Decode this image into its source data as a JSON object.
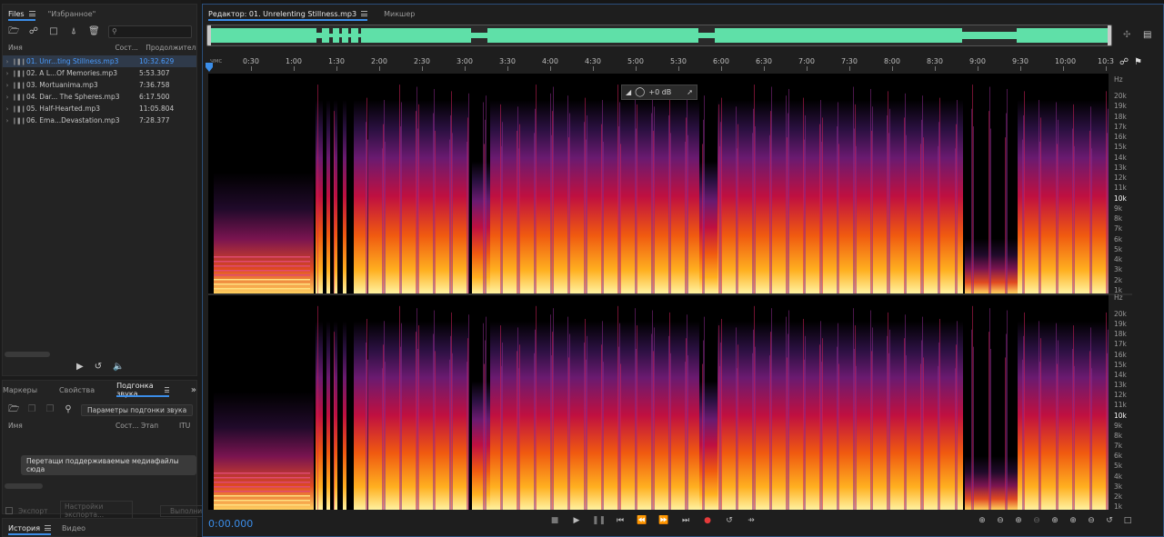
{
  "files_panel": {
    "tabs": [
      {
        "label": "Files",
        "active": true
      },
      {
        "label": "\"Избранное\"",
        "active": false
      }
    ],
    "search_placeholder": "",
    "columns": {
      "name": "Имя",
      "status": "Сост...",
      "duration": "Продолжительн..."
    },
    "files": [
      {
        "name": "01. Unr...ting Stillness.mp3",
        "duration": "10:32.629",
        "selected": true
      },
      {
        "name": "02. A L...Of Memories.mp3",
        "duration": "5:53.307",
        "selected": false
      },
      {
        "name": "03. Mortuanima.mp3",
        "duration": "7:36.758",
        "selected": false
      },
      {
        "name": "04. Dar... The Spheres.mp3",
        "duration": "6:17.500",
        "selected": false
      },
      {
        "name": "05. Half-Hearted.mp3",
        "duration": "11:05.804",
        "selected": false
      },
      {
        "name": "06. Ema...Devastation.mp3",
        "duration": "7:28.377",
        "selected": false
      }
    ]
  },
  "match_panel": {
    "tabs": [
      {
        "label": "Маркеры",
        "active": false
      },
      {
        "label": "Свойства",
        "active": false
      },
      {
        "label": "Подгонка звука",
        "active": true
      }
    ],
    "params_button": "Параметры подгонки звука",
    "columns": {
      "name": "Имя",
      "status": "Сост...",
      "stage": "Этап",
      "itu": "ITU"
    },
    "drop_hint": "Перетащи поддерживаемые медиафайлы сюда",
    "export_checkbox": "Экспорт",
    "export_settings": "Настройки экспорта...",
    "run_button": "Выполнить"
  },
  "bottom_tabs": [
    {
      "label": "История",
      "active": true
    },
    {
      "label": "Видео",
      "active": false
    }
  ],
  "editor": {
    "tabs": [
      {
        "label": "Редактор: 01. Unrelenting Stillness.mp3",
        "active": true
      },
      {
        "label": "Микшер",
        "active": false
      }
    ],
    "ruler_unit": "чмс",
    "ruler_ticks": [
      "0:30",
      "1:00",
      "1:30",
      "2:00",
      "2:30",
      "3:00",
      "3:30",
      "4:00",
      "4:30",
      "5:00",
      "5:30",
      "6:00",
      "6:30",
      "7:00",
      "7:30",
      "8:00",
      "8:30",
      "9:00",
      "9:30",
      "10:00",
      "10:3"
    ],
    "hud_gain": "+0 dB",
    "hz_unit": "Hz",
    "hz_labels": [
      "20k",
      "19k",
      "18k",
      "17k",
      "16k",
      "15k",
      "14k",
      "13k",
      "12k",
      "11k",
      "10k",
      "9k",
      "8k",
      "7k",
      "6k",
      "5k",
      "4k",
      "3k",
      "2k",
      "1k"
    ],
    "current_time": "0:00.000"
  },
  "colors": {
    "accent": "#3b8de8",
    "waveform": "#5fe0a8",
    "selected_file": "#4a9cff",
    "record": "#e53a3a"
  }
}
